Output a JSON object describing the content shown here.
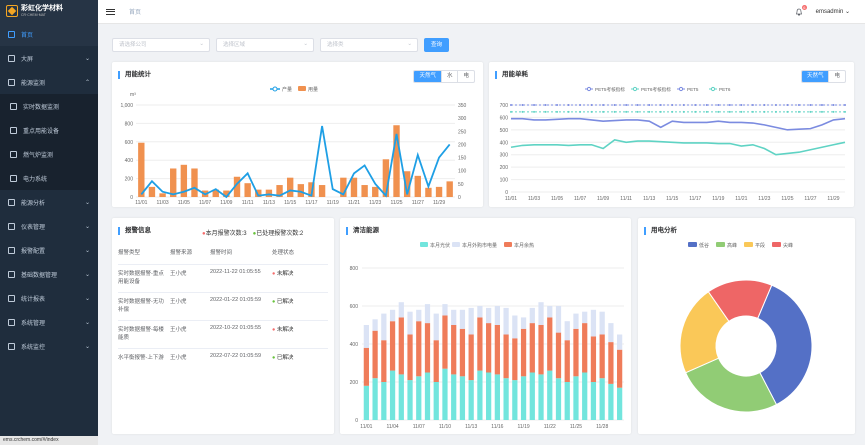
{
  "app": {
    "logo_cn": "彩虹化学材料",
    "logo_en": "CR·CHEM·MAT",
    "status_url": "ems.crchem.com/#/index"
  },
  "header": {
    "breadcrumb": "首页",
    "badge": "6",
    "user": "emsadmin ⌄"
  },
  "sidebar": {
    "items": [
      {
        "label": "首页",
        "active": true,
        "icon": "home-icon"
      },
      {
        "label": "大屏",
        "arrow": true,
        "icon": "screen-icon"
      },
      {
        "label": "能源监测",
        "arrow": true,
        "icon": "monitor-icon"
      },
      {
        "label": "实时数据监测",
        "sub": true,
        "icon": "data-icon"
      },
      {
        "label": "重点用能设备",
        "sub": true,
        "icon": "device-icon"
      },
      {
        "label": "燃气炉监测",
        "sub": true,
        "icon": "furnace-icon"
      },
      {
        "label": "电力系统",
        "sub": true,
        "icon": "power-icon"
      },
      {
        "label": "能源分析",
        "arrow": true,
        "icon": "analysis-icon"
      },
      {
        "label": "仪表管理",
        "arrow": true,
        "icon": "meter-icon"
      },
      {
        "label": "报警配置",
        "arrow": true,
        "icon": "alarm-icon"
      },
      {
        "label": "基础数据管理",
        "arrow": true,
        "icon": "database-icon"
      },
      {
        "label": "统计报表",
        "arrow": true,
        "icon": "report-icon"
      },
      {
        "label": "系统管理",
        "arrow": true,
        "icon": "settings-icon"
      },
      {
        "label": "系统监控",
        "arrow": true,
        "icon": "watch-icon"
      }
    ]
  },
  "filters": {
    "company": "请选择公司",
    "area": "选择区域",
    "product": "选择类",
    "query": "查询"
  },
  "energy_stats": {
    "title": "用能统计",
    "tabs": [
      "天然气",
      "水",
      "电"
    ],
    "active_tab": 0,
    "unit": "m³"
  },
  "energy_unit": {
    "title": "用能单耗",
    "tabs": [
      "天然气",
      "电"
    ],
    "active_tab": 0
  },
  "alarm": {
    "title": "报警信息",
    "month_alarms": "本月报警次数:3",
    "handled": "已处理报警次数:2",
    "columns": [
      "报警类型",
      "报警来源",
      "报警时间",
      "处理状态"
    ],
    "rows": [
      {
        "type": "实时数据报警-重点用能设备",
        "source": "王小虎",
        "time": "2022-11-22 01:05:55",
        "status": "未解决",
        "color": "#f56c6c"
      },
      {
        "type": "实时数据报警-无功补偿",
        "source": "王小虎",
        "time": "2022-01-22 01:05:59",
        "status": "已解决",
        "color": "#67c23a"
      },
      {
        "type": "实时数据报警-每楼能质",
        "source": "王小虎",
        "time": "2022-10-22 01:05:55",
        "status": "未解决",
        "color": "#f56c6c"
      },
      {
        "type": "水平衡报警-上下游",
        "source": "王小虎",
        "time": "2022-07-22 01:05:59",
        "status": "已解决",
        "color": "#67c23a"
      }
    ]
  },
  "clean": {
    "title": "清洁能源"
  },
  "power": {
    "title": "用电分析"
  },
  "chart_data": [
    {
      "type": "bar",
      "title": "用能统计",
      "legend": [
        "产量",
        "用量"
      ],
      "categories": [
        "11/01",
        "11/02",
        "11/03",
        "11/04",
        "11/05",
        "11/06",
        "11/07",
        "11/08",
        "11/09",
        "11/10",
        "11/11",
        "11/12",
        "11/13",
        "11/14",
        "11/15",
        "11/16",
        "11/17",
        "11/18",
        "11/19",
        "11/20",
        "11/21",
        "11/22",
        "11/23",
        "11/24",
        "11/25",
        "11/26",
        "11/27",
        "11/28",
        "11/29",
        "11/30"
      ],
      "series": [
        {
          "name": "用量",
          "axis": "left",
          "values": [
            590,
            110,
            40,
            310,
            350,
            310,
            70,
            80,
            70,
            220,
            150,
            80,
            80,
            130,
            210,
            140,
            160,
            130,
            0,
            210,
            210,
            130,
            110,
            410,
            780,
            280,
            230,
            100,
            110,
            170
          ]
        },
        {
          "name": "产量",
          "axis": "right",
          "values": [
            10,
            60,
            20,
            10,
            20,
            35,
            10,
            30,
            0,
            50,
            90,
            5,
            10,
            5,
            25,
            20,
            5,
            270,
            30,
            10,
            90,
            120,
            50,
            5,
            240,
            10,
            160,
            40,
            150,
            200
          ]
        }
      ],
      "yleft": [
        0,
        1000
      ],
      "yright": [
        0,
        350
      ],
      "yticks_left": [
        "0",
        "200",
        "400",
        "600",
        "800",
        "1,000"
      ],
      "yticks_right": [
        "0",
        "50",
        "100",
        "150",
        "200",
        "250",
        "300",
        "350"
      ]
    },
    {
      "type": "line",
      "title": "用能单耗",
      "legend": [
        "PET5考核指标",
        "PET6考核指标",
        "PET5",
        "PET6"
      ],
      "categories": [
        "11/01",
        "11/03",
        "11/05",
        "11/07",
        "11/09",
        "11/11",
        "11/13",
        "11/15",
        "11/17",
        "11/19",
        "11/21",
        "11/23",
        "11/25",
        "11/27",
        "11/29"
      ],
      "x": [
        1,
        2,
        3,
        4,
        5,
        6,
        7,
        8,
        9,
        10,
        11,
        12,
        13,
        14,
        15,
        16,
        17,
        18,
        19,
        20,
        21,
        22,
        23,
        24,
        25,
        26,
        27,
        28,
        29,
        30
      ],
      "series": [
        {
          "name": "PET5考核指标",
          "color": "#7b8be0",
          "dashed": true,
          "values": [
            700,
            700,
            700,
            700,
            700,
            700,
            700,
            700,
            700,
            700,
            700,
            700,
            700,
            700,
            700,
            700,
            700,
            700,
            700,
            700,
            700,
            700,
            700,
            700,
            700,
            700,
            700,
            700,
            700,
            700
          ]
        },
        {
          "name": "PET6考核指标",
          "color": "#5fd3c4",
          "dashed": true,
          "values": [
            645,
            645,
            645,
            645,
            645,
            645,
            645,
            645,
            645,
            645,
            645,
            645,
            645,
            645,
            645,
            645,
            645,
            645,
            645,
            645,
            645,
            645,
            645,
            645,
            645,
            645,
            645,
            645,
            645,
            645
          ]
        },
        {
          "name": "PET5",
          "color": "#7b8be0",
          "values": [
            590,
            590,
            580,
            580,
            585,
            590,
            590,
            580,
            570,
            575,
            580,
            580,
            570,
            520,
            570,
            560,
            560,
            560,
            570,
            560,
            560,
            555,
            540,
            520,
            500,
            505,
            510,
            540,
            580,
            590
          ]
        },
        {
          "name": "PET6",
          "color": "#5fd3c4",
          "values": [
            360,
            375,
            380,
            380,
            380,
            375,
            380,
            380,
            350,
            420,
            400,
            410,
            410,
            405,
            400,
            395,
            395,
            395,
            390,
            390,
            370,
            380,
            350,
            300,
            310,
            320,
            340,
            360,
            380,
            400
          ]
        }
      ],
      "ylim": [
        0,
        700
      ],
      "yticks": [
        "0",
        "100",
        "200",
        "300",
        "400",
        "500",
        "600",
        "700"
      ]
    },
    {
      "type": "bar",
      "title": "清洁能源",
      "legend": [
        "本月光伏",
        "本月外购市电量",
        "本月余热"
      ],
      "categories": [
        "11/01",
        "11/04",
        "11/07",
        "11/10",
        "11/13",
        "11/16",
        "11/19",
        "11/22",
        "11/25",
        "11/28"
      ],
      "series": [
        {
          "name": "本月光伏",
          "values": [
            180,
            220,
            200,
            260,
            240,
            210,
            230,
            250,
            200,
            270,
            240,
            230,
            210,
            260,
            250,
            240,
            220,
            210,
            230,
            250,
            240,
            260,
            220,
            200,
            230,
            250,
            200,
            220,
            190,
            170
          ]
        },
        {
          "name": "本月余热",
          "values": [
            200,
            250,
            220,
            260,
            300,
            240,
            290,
            260,
            220,
            280,
            260,
            250,
            240,
            280,
            260,
            260,
            230,
            220,
            250,
            260,
            260,
            280,
            240,
            220,
            250,
            260,
            240,
            230,
            220,
            200
          ]
        },
        {
          "name": "本月外购市电量",
          "values": [
            120,
            60,
            140,
            60,
            80,
            120,
            60,
            100,
            140,
            60,
            80,
            100,
            140,
            60,
            80,
            100,
            140,
            120,
            60,
            80,
            120,
            60,
            140,
            100,
            80,
            60,
            140,
            120,
            100,
            80
          ]
        }
      ],
      "ylim": [
        0,
        800
      ],
      "yticks": [
        "0",
        "200",
        "400",
        "600",
        "800"
      ]
    },
    {
      "type": "pie",
      "title": "用电分析",
      "legend": [
        "低谷",
        "高峰",
        "平段",
        "尖峰"
      ],
      "colors": [
        "#5470c6",
        "#91cc75",
        "#fac858",
        "#ee6666"
      ],
      "values": [
        36,
        26,
        22,
        16
      ]
    }
  ]
}
